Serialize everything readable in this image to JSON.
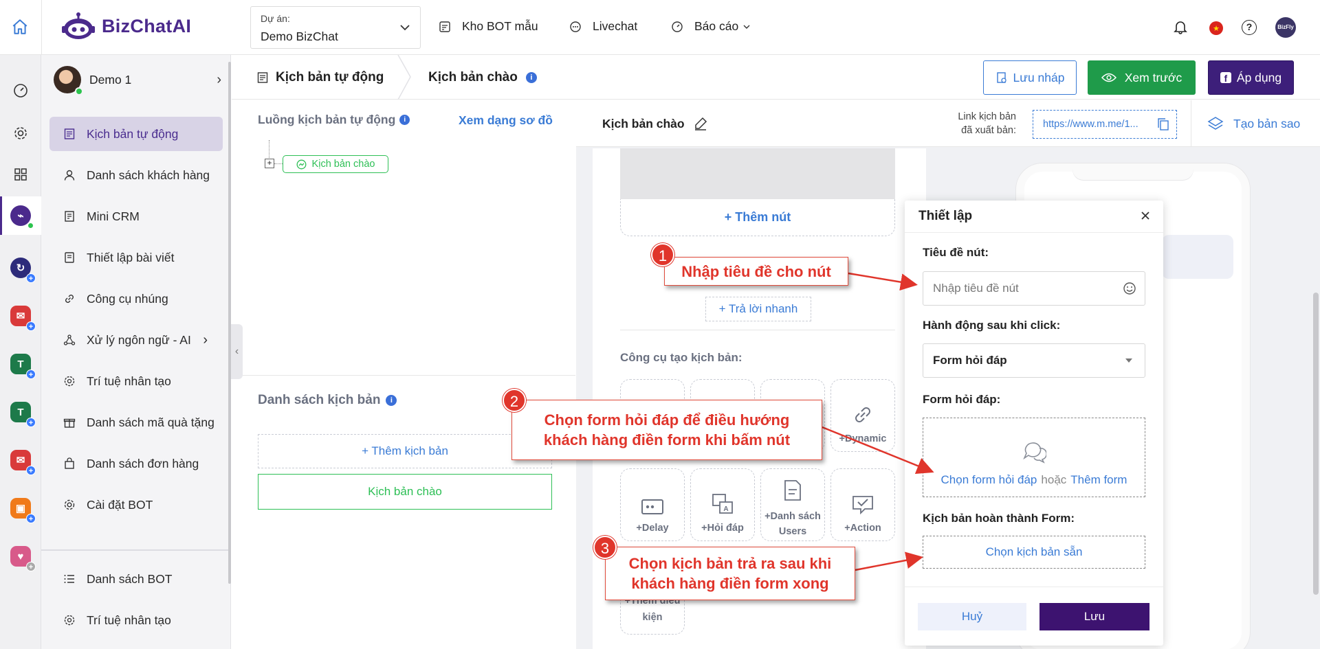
{
  "brand": {
    "name": "BizChatAI"
  },
  "project": {
    "label": "Dự án:",
    "value": "Demo BizChat"
  },
  "topnav": {
    "bot_store": "Kho BOT mẫu",
    "livechat": "Livechat",
    "report": "Báo cáo"
  },
  "account": {
    "name": "Demo 1"
  },
  "sidebar": {
    "items": [
      {
        "label": "Kịch bản tự động",
        "icon": "script-icon",
        "active": true
      },
      {
        "label": "Danh sách khách hàng",
        "icon": "user-icon"
      },
      {
        "label": "Mini CRM",
        "icon": "crm-icon"
      },
      {
        "label": "Thiết lập bài viết",
        "icon": "post-icon"
      },
      {
        "label": "Công cụ nhúng",
        "icon": "link-icon"
      },
      {
        "label": "Xử lý ngôn ngữ - AI",
        "icon": "nlp-icon"
      },
      {
        "label": "Trí tuệ nhân tạo",
        "icon": "ai-icon"
      },
      {
        "label": "Danh sách mã quà tặng",
        "icon": "gift-icon"
      },
      {
        "label": "Danh sách đơn hàng",
        "icon": "bag-icon"
      },
      {
        "label": "Cài đặt BOT",
        "icon": "gear-icon"
      }
    ],
    "bottom": [
      {
        "label": "Danh sách BOT",
        "icon": "list-icon"
      },
      {
        "label": "Trí tuệ nhân tạo",
        "icon": "ai-icon"
      }
    ]
  },
  "header": {
    "breadcrumb_1": "Kịch bản tự động",
    "breadcrumb_2": "Kịch bản chào",
    "save_draft": "Lưu nháp",
    "preview": "Xem trước",
    "apply": "Áp dụng"
  },
  "flow": {
    "title": "Luồng kịch bản tự động",
    "diagram_link": "Xem dạng sơ đồ",
    "node": "Kịch bản chào"
  },
  "scripts": {
    "title": "Danh sách kịch bản",
    "add": "+ Thêm kịch bản",
    "items": [
      "Kịch bản chào"
    ]
  },
  "editor": {
    "title": "Kịch bản chào",
    "link_label_1": "Link kịch bản",
    "link_label_2": "đã xuất bản:",
    "link_value": "https://www.m.me/1...",
    "duplicate": "Tạo bản sao",
    "add_button": "+ Thêm nút",
    "quick_reply": "+ Trả lời nhanh",
    "tools_title": "Công cụ tạo kịch bản:",
    "tools": [
      {
        "label": "+Dynamic",
        "icon": "link-icon"
      },
      {
        "label": "+Delay",
        "icon": "delay-icon"
      },
      {
        "label": "+Hỏi đáp",
        "icon": "qa-icon"
      },
      {
        "label": "+Danh sách Users",
        "icon": "user-list-icon"
      },
      {
        "label": "+Action",
        "icon": "action-icon"
      },
      {
        "label": "+Thêm điều kiện",
        "icon": "condition-icon"
      }
    ]
  },
  "modal": {
    "title": "Thiết lập",
    "button_title_label": "Tiêu đề nút:",
    "button_title_placeholder": "Nhập tiêu đề nút",
    "action_label": "Hành động sau khi click:",
    "action_value": "Form hỏi đáp",
    "form_label": "Form hỏi đáp:",
    "choose_form": "Chọn form hỏi đáp",
    "or": "hoặc",
    "add_form": "Thêm form",
    "complete_label": "Kịch bản hoàn thành Form:",
    "choose_script": "Chọn kịch bản sẵn",
    "cancel": "Huỷ",
    "save": "Lưu"
  },
  "callouts": [
    {
      "num": "1",
      "text": "Nhập tiêu đề cho nút"
    },
    {
      "num": "2",
      "line1": "Chọn form hỏi đáp để điều hướng",
      "line2": "khách hàng điền form khi bấm nút"
    },
    {
      "num": "3",
      "line1": "Chọn kịch bản trả ra sau khi",
      "line2": "khách hàng điền form xong"
    }
  ],
  "colors": {
    "brand": "#4b2a8c",
    "green": "#1f9b4a",
    "blue": "#3a7bd5",
    "red": "#e0352b"
  }
}
